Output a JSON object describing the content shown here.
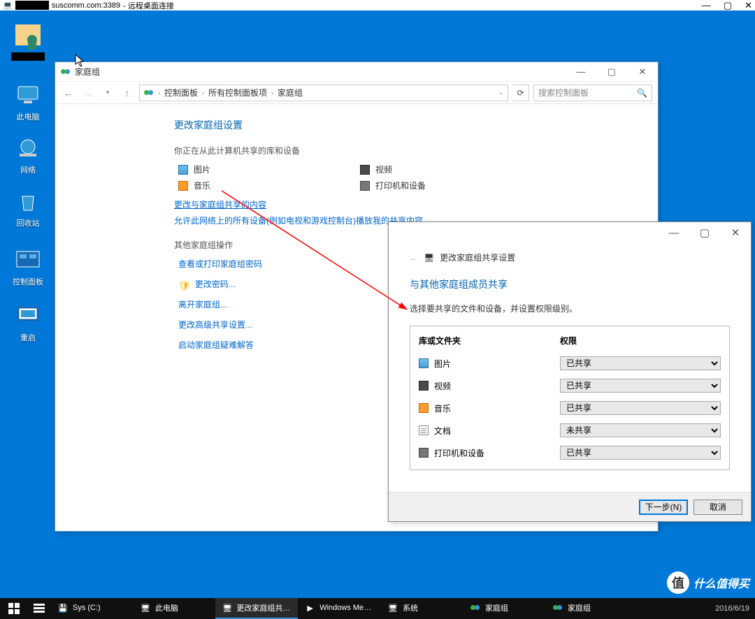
{
  "rdp": {
    "host_suffix": "suscomm.com:3389",
    "title_suffix": " - 远程桌面连接"
  },
  "desktop_icons": {
    "thispc": "此电脑",
    "network": "网络",
    "recycle": "回收站",
    "cpanel": "控制面板",
    "restart": "重启"
  },
  "cp_window": {
    "title": "家庭组",
    "crumbs": [
      "控制面板",
      "所有控制面板项",
      "家庭组"
    ],
    "search_placeholder": "搜索控制面板",
    "heading": "更改家庭组设置",
    "sub1": "你正在从此计算机共享的库和设备",
    "shared": {
      "pics": "图片",
      "video": "视频",
      "music": "音乐",
      "printers": "打印机和设备"
    },
    "link_change_share": "更改与家庭组共享的内容",
    "link_allow_net": "允许此网络上的所有设备(例如电视和游戏控制台)播放我的共享内容",
    "sub2": "其他家庭组操作",
    "ops": {
      "view_pw": "查看或打印家庭组密码",
      "change_pw": "更改密码...",
      "leave": "离开家庭组...",
      "adv": "更改高级共享设置...",
      "troubleshoot": "启动家庭组疑难解答"
    }
  },
  "share_dialog": {
    "back_title": "更改家庭组共享设置",
    "heading": "与其他家庭组成员共享",
    "desc": "选择要共享的文件和设备，并设置权限级别。",
    "col1": "库或文件夹",
    "col2": "权限",
    "rows": [
      {
        "label": "图片",
        "icon": "ib-img",
        "value": "已共享"
      },
      {
        "label": "视频",
        "icon": "ib-vid",
        "value": "已共享"
      },
      {
        "label": "音乐",
        "icon": "ib-mus",
        "value": "已共享"
      },
      {
        "label": "文档",
        "icon": "ib-doc",
        "value": "未共享"
      },
      {
        "label": "打印机和设备",
        "icon": "ib-prn",
        "value": "已共享"
      }
    ],
    "options": [
      "已共享",
      "未共享"
    ],
    "btn_next": "下一步(N)",
    "btn_cancel": "取消"
  },
  "taskbar": {
    "items": [
      {
        "label": "Sys (C:)"
      },
      {
        "label": "此电脑"
      },
      {
        "label": "更改家庭组共享...",
        "active": true
      },
      {
        "label": "Windows Medi..."
      },
      {
        "label": "系统"
      },
      {
        "label": "家庭组"
      },
      {
        "label": "家庭组"
      }
    ],
    "date": "2016/6/19"
  },
  "watermark": {
    "badge": "值",
    "text": "什么值得买"
  }
}
